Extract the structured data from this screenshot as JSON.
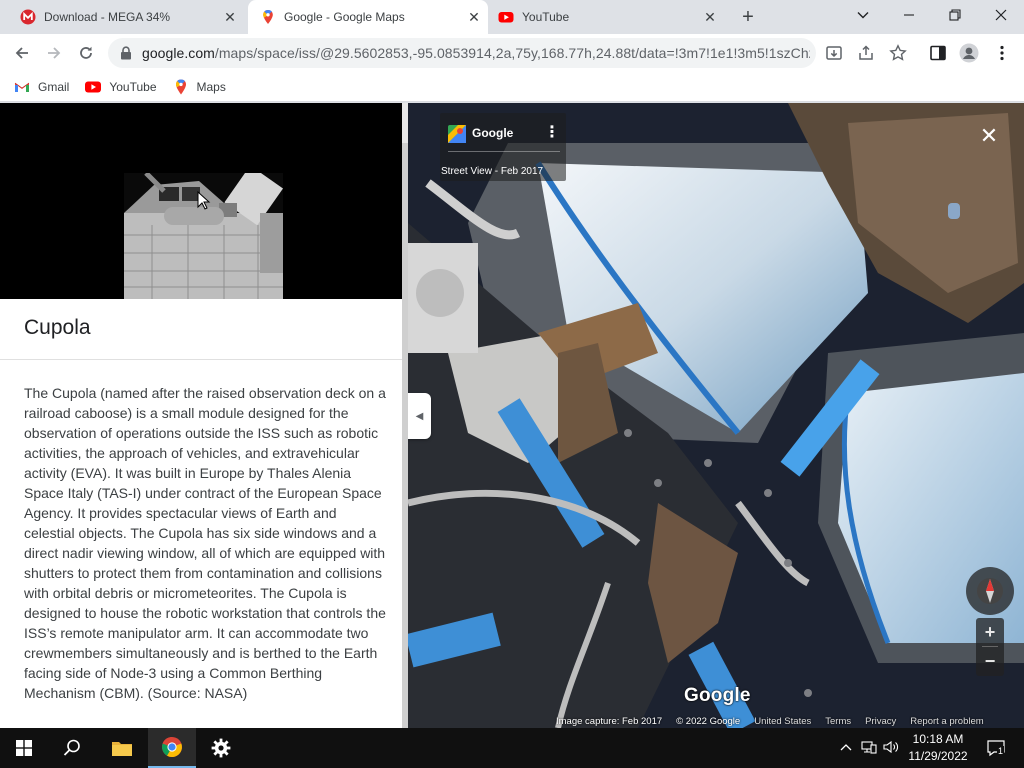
{
  "browser": {
    "tabs": [
      {
        "label": "Download - MEGA 34%",
        "icon": "mega-icon",
        "active": false
      },
      {
        "label": "Google - Google Maps",
        "icon": "google-maps-icon",
        "active": true
      },
      {
        "label": "YouTube",
        "icon": "youtube-icon",
        "active": false
      }
    ],
    "new_tab_glyph": "+",
    "url_host": "google.com",
    "url_path": "/maps/space/iss/@29.5602853,-95.0853914,2a,75y,168.77h,24.88t/data=!3m7!1e1!3m5!1szChz..."
  },
  "bookmarks": [
    {
      "label": "Gmail",
      "icon": "gmail-icon"
    },
    {
      "label": "YouTube",
      "icon": "youtube-icon"
    },
    {
      "label": "Maps",
      "icon": "google-maps-icon"
    }
  ],
  "place": {
    "title": "Cupola",
    "description": "The Cupola (named after the raised observation deck on a railroad caboose) is a small module designed for the observation of operations outside the ISS such as robotic activities, the approach of vehicles, and extravehicular activity (EVA). It was built in Europe by Thales Alenia Space Italy (TAS-I) under contract of the European Space Agency. It provides spectacular views of Earth and celestial objects. The Cupola has six side windows and a direct nadir viewing window, all of which are equipped with shutters to protect them from contamination and collisions with orbital debris or micrometeorites. The Cupola is designed to house the robotic workstation that controls the ISS’s remote manipulator arm. It can accommodate two crewmembers simultaneously and is berthed to the Earth facing side of Node-3 using a Common Berthing Mechanism (CBM). (Source: NASA)"
  },
  "streetview": {
    "provider": "Google",
    "subtitle": "Street View - Feb 2017",
    "watermark": "Google",
    "attribution": [
      "Image capture: Feb 2017",
      "© 2022 Google",
      "United States",
      "Terms",
      "Privacy",
      "Report a problem"
    ],
    "zoom_in": "+",
    "zoom_out": "−",
    "close_glyph": "✕"
  },
  "taskbar": {
    "pinned": [
      "windows-start",
      "search",
      "file-explorer",
      "chrome",
      "settings"
    ],
    "active": "chrome",
    "clock_time": "10:18 AM",
    "clock_date": "11/29/2022",
    "notification_count": "1"
  },
  "colors": {
    "chrome_frame": "#dee1e6",
    "taskbar": "#101010",
    "youtube_red": "#ff0000",
    "maps_yellow": "#fbbc04"
  }
}
